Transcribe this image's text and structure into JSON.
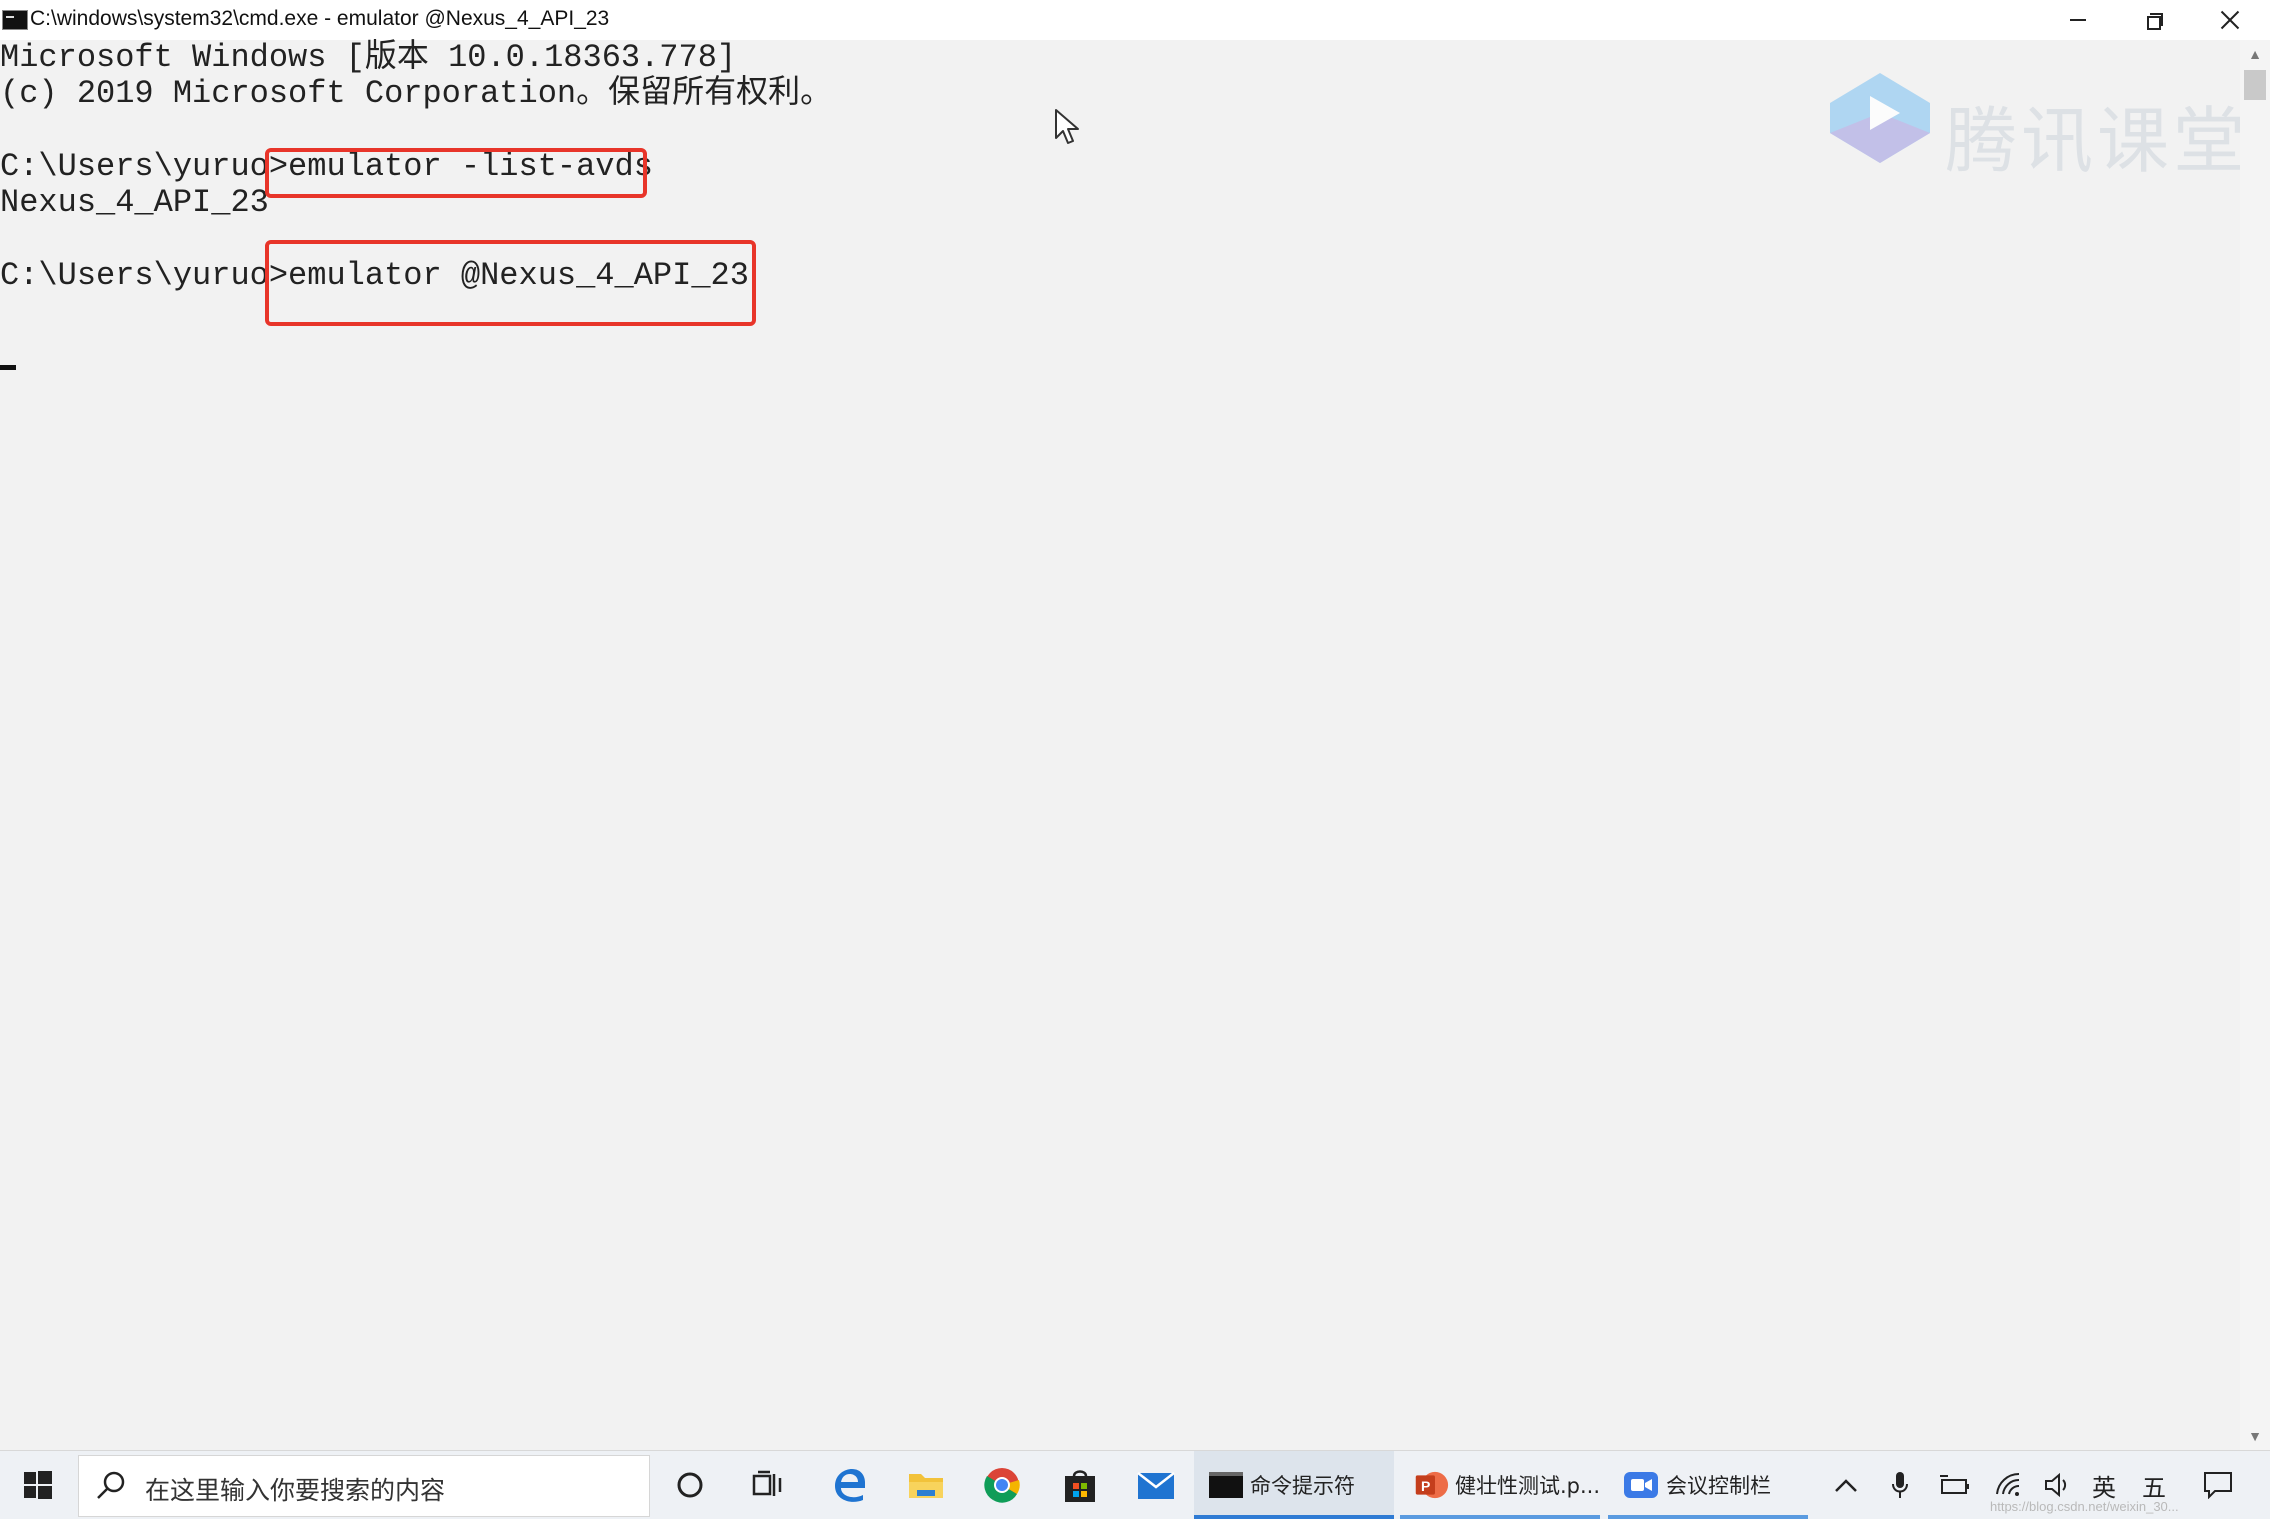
{
  "window": {
    "title": "C:\\windows\\system32\\cmd.exe - emulator  @Nexus_4_API_23"
  },
  "console": {
    "lines": [
      "Microsoft Windows [版本 10.0.18363.778]",
      "(c) 2019 Microsoft Corporation。保留所有权利。",
      "",
      "C:\\Users\\yuruo>emulator -list-avds",
      "Nexus_4_API_23",
      "",
      "C:\\Users\\yuruo>emulator @Nexus_4_API_23"
    ],
    "highlighted_commands": [
      "emulator -list-avds",
      "emulator @Nexus_4_API_23"
    ],
    "highlight_color": "#e8352a"
  },
  "watermark": {
    "brand": "腾讯课堂",
    "url": "https://blog.csdn.net/weixin_30..."
  },
  "taskbar": {
    "search_placeholder": "在这里输入你要搜索的内容",
    "tasks": [
      {
        "label": "命令提示符",
        "icon": "cmd-icon",
        "active": true
      },
      {
        "label": "健壮性测试.p...",
        "icon": "powerpoint-icon",
        "active": false
      },
      {
        "label": "会议控制栏",
        "icon": "meeting-icon",
        "active": false
      }
    ],
    "pinned_icons": [
      "cortana-icon",
      "task-view-icon",
      "edge-icon",
      "file-explorer-icon",
      "chrome-icon",
      "store-icon",
      "mail-icon"
    ],
    "tray": {
      "ime_language": "英",
      "ime_mode": "五"
    }
  },
  "colors": {
    "console_bg": "#f2f2f2",
    "console_text": "#222222",
    "accent": "#2f7bd4"
  }
}
